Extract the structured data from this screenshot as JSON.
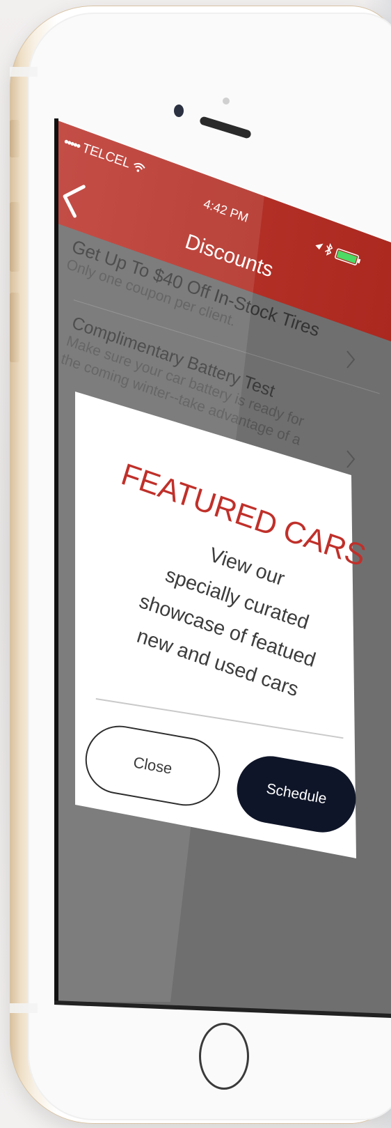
{
  "status_bar": {
    "signal_dots": "•••••",
    "carrier": "TELCEL",
    "wifi_icon": "wifi-icon",
    "time": "4:42 PM",
    "location_icon": "location-icon",
    "bluetooth_icon": "bluetooth-icon",
    "battery_icon": "battery-icon"
  },
  "nav": {
    "back_icon": "chevron-left-icon",
    "title": "Discounts"
  },
  "list": [
    {
      "title_pre": "Get Up To $40 Off ",
      "title_bold": "In-Stock Tires",
      "subtitle": "Only one coupon per client."
    },
    {
      "title_pre": "Complimentary Battery Test",
      "title_bold": "",
      "subtitle_lines": [
        "Make sure your car battery is ready for",
        "the coming winter--take advantage of a"
      ]
    }
  ],
  "chevron_icon": "chevron-right-icon",
  "modal": {
    "title": "FEATURED CARS",
    "body_lines": [
      "View our",
      "specially curated",
      "showcase of featued",
      "new and used cars"
    ],
    "close_label": "Close",
    "schedule_label": "Schedule"
  },
  "colors": {
    "header_red": "#b53229",
    "title_red": "#c0302a",
    "schedule_navy": "#0f1528",
    "overlay_gray": "#6f6f6f",
    "phone_gold": "#e8d6ba"
  }
}
